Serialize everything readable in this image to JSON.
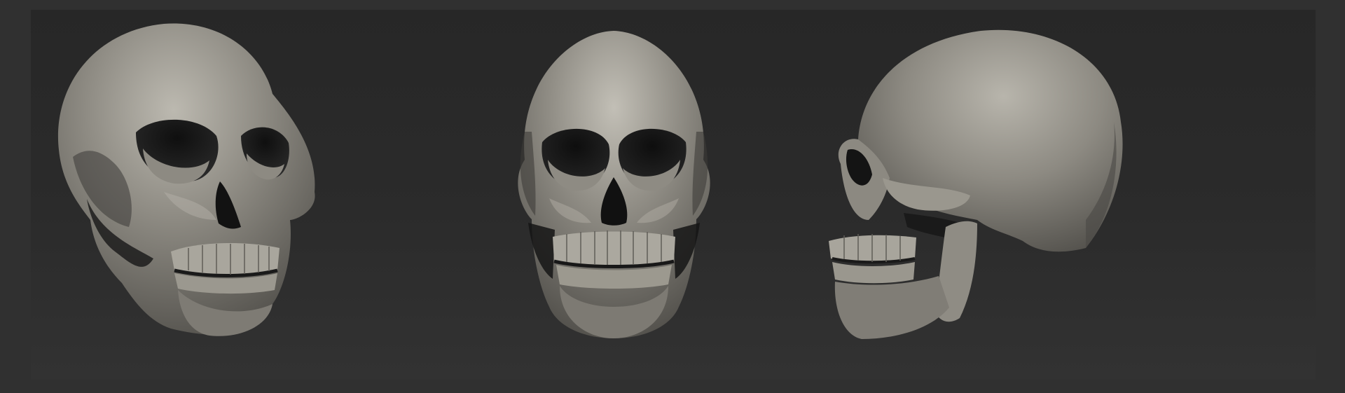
{
  "scene": {
    "background_color": "#303030",
    "viewport_color": "#2a2a2a",
    "material_color": "#8e8b82",
    "views": [
      {
        "view": "three-quarter",
        "icon": "skull-three-quarter-render"
      },
      {
        "view": "front",
        "icon": "skull-front-render"
      },
      {
        "view": "profile",
        "icon": "skull-side-render"
      }
    ]
  }
}
